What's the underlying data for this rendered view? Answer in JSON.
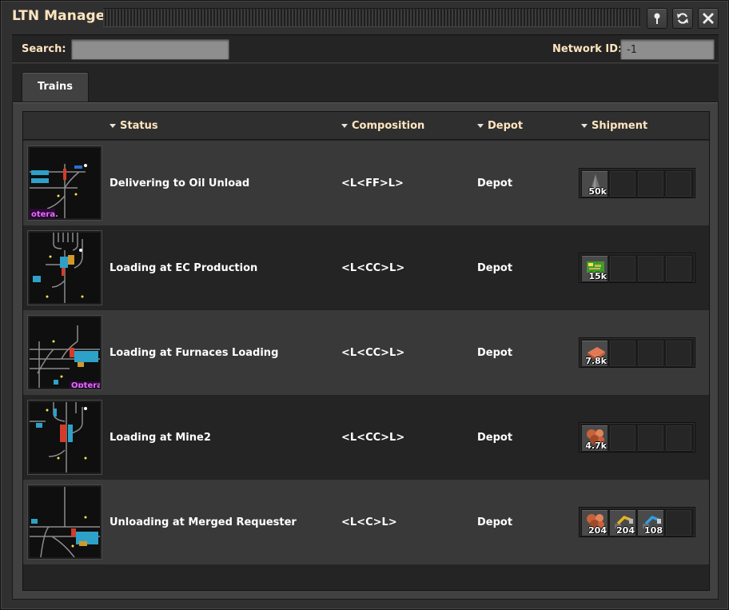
{
  "window": {
    "title": "LTN Manager"
  },
  "titlebar_buttons": [
    {
      "icon": "pin-icon"
    },
    {
      "icon": "refresh-icon"
    },
    {
      "icon": "close-icon"
    }
  ],
  "toolbar": {
    "search_label": "Search:",
    "search_value": "",
    "network_label": "Network ID:",
    "network_value": "-1"
  },
  "tabs": [
    {
      "label": "Trains",
      "selected": true
    }
  ],
  "table": {
    "columns": [
      {
        "label": "Status",
        "sort": "desc"
      },
      {
        "label": "Composition",
        "sort": "desc"
      },
      {
        "label": "Depot",
        "sort": "desc"
      },
      {
        "label": "Shipment",
        "sort": "desc"
      }
    ],
    "rows": [
      {
        "status": "Delivering to Oil Unload",
        "composition": "<L<FF>L>",
        "depot": "Depot",
        "minimap_text": "otera.",
        "shipment": [
          {
            "icon": "crude-oil-icon",
            "count": "50k"
          }
        ]
      },
      {
        "status": "Loading at EC Production",
        "composition": "<L<CC>L>",
        "depot": "Depot",
        "minimap_text": "",
        "shipment": [
          {
            "icon": "electronic-circuit-icon",
            "count": "15k"
          }
        ]
      },
      {
        "status": "Loading at Furnaces Loading",
        "composition": "<L<CC>L>",
        "depot": "Depot",
        "minimap_text": "Optera",
        "shipment": [
          {
            "icon": "copper-plate-icon",
            "count": "7.8k"
          }
        ]
      },
      {
        "status": "Loading at Mine2",
        "composition": "<L<CC>L>",
        "depot": "Depot",
        "minimap_text": "",
        "shipment": [
          {
            "icon": "copper-ore-icon",
            "count": "4.7k"
          }
        ]
      },
      {
        "status": "Unloading at Merged Requester",
        "composition": "<L<C>L>",
        "depot": "Depot",
        "minimap_text": "",
        "shipment": [
          {
            "icon": "copper-ore-icon",
            "count": "204"
          },
          {
            "icon": "yellow-inserter-icon",
            "count": "204"
          },
          {
            "icon": "fast-inserter-icon",
            "count": "108"
          }
        ]
      }
    ]
  },
  "colors": {
    "heading": "#ffe6c0",
    "window_bg": "#313031",
    "row_even": "#393939",
    "row_odd": "#242424"
  }
}
